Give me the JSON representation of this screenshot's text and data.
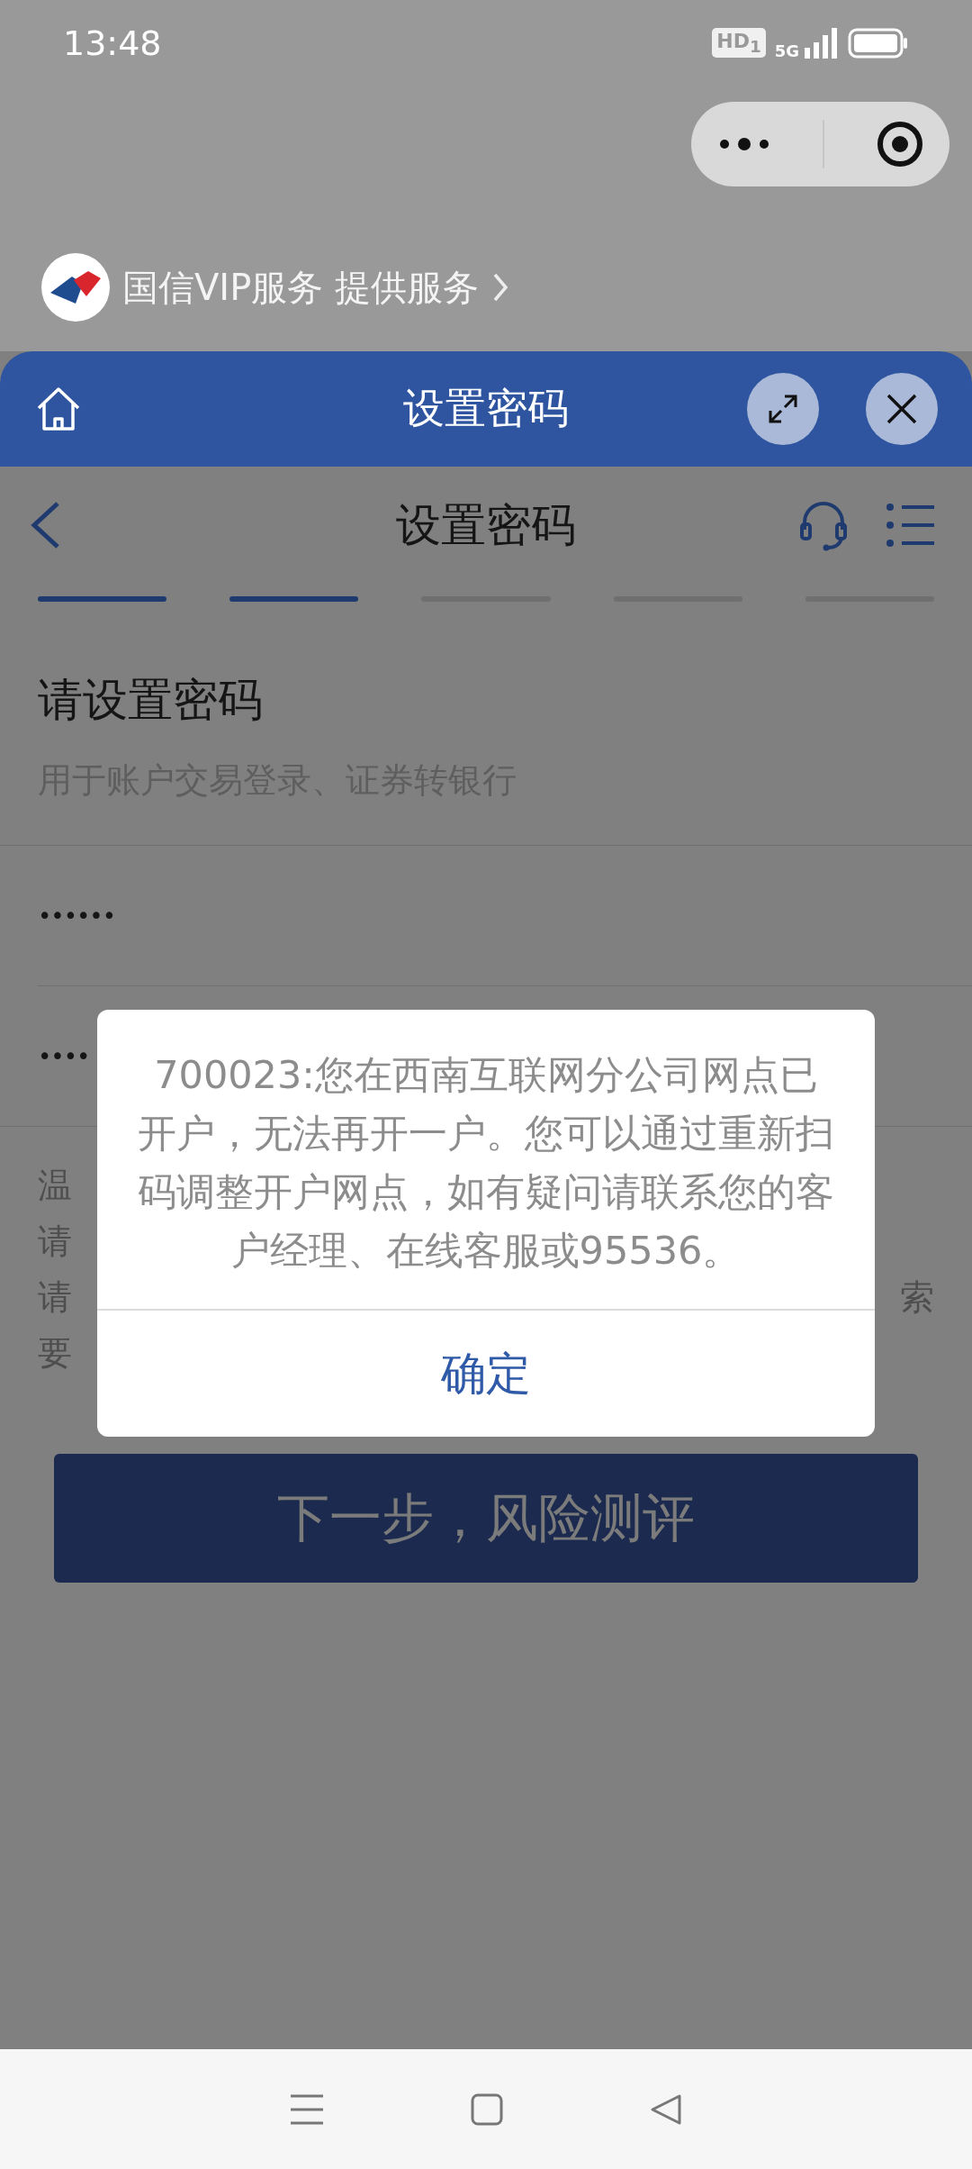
{
  "status_bar": {
    "time": "13:48",
    "hd_badge": "HD$_{1}$",
    "network": "5G"
  },
  "provider": {
    "name": "国信VIP服务 提供服务"
  },
  "sheet": {
    "title": "设置密码"
  },
  "page": {
    "nav_title": "设置密码",
    "steps": [
      {
        "done": true
      },
      {
        "done": true
      },
      {
        "done": false
      },
      {
        "done": false
      },
      {
        "done": false
      }
    ],
    "heading": "请设置密码",
    "subheading": "用于账户交易登录、证券转银行",
    "password_fields": [
      {
        "value": "••••••"
      },
      {
        "value": "••••"
      }
    ],
    "tips": [
      {
        "start": "温"
      },
      {
        "start": "请"
      },
      {
        "start": "请",
        "end": "索"
      },
      {
        "start": "要"
      }
    ],
    "next_button": "下一步，风险测评"
  },
  "dialog": {
    "message": "700023:您在西南互联网分公司网点已开户，无法再开一户。您可以通过重新扫码调整开户网点，如有疑问请联系您的客户经理、在线客服或95536。",
    "confirm": "确定"
  }
}
